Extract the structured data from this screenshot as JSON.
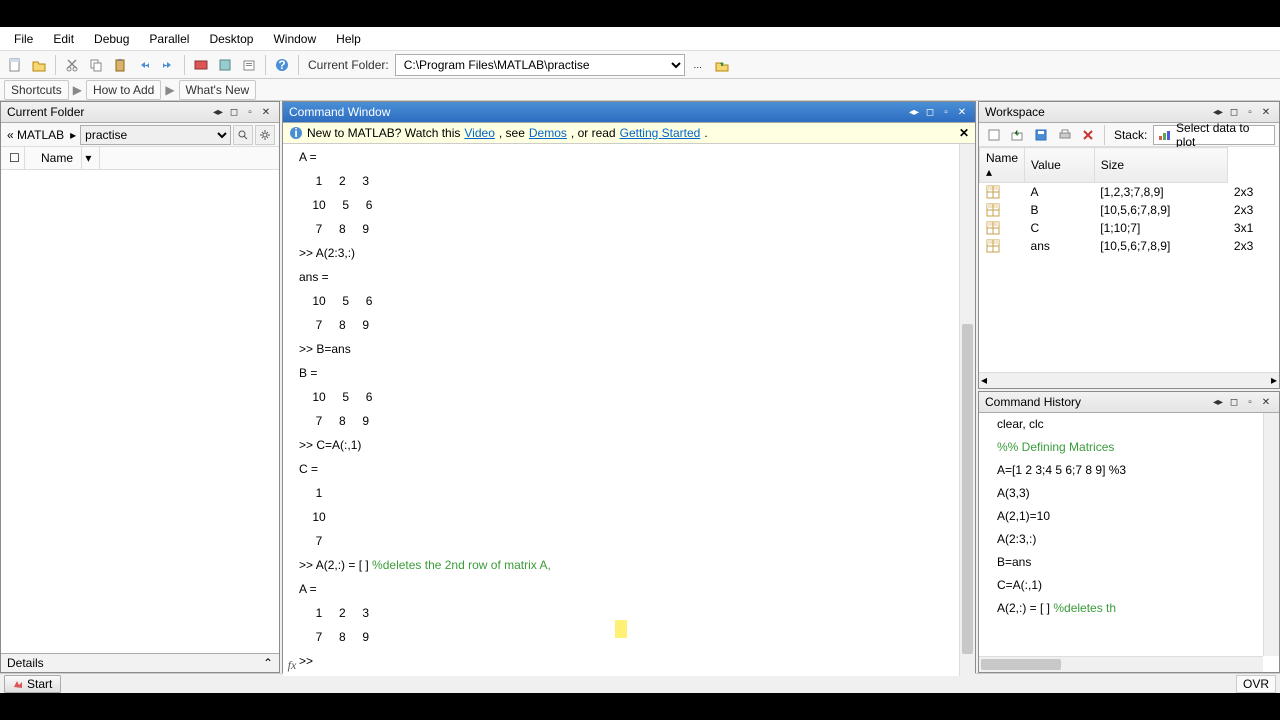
{
  "menubar": [
    "File",
    "Edit",
    "Debug",
    "Parallel",
    "Desktop",
    "Window",
    "Help"
  ],
  "toolbar": {
    "current_folder_label": "Current Folder:",
    "current_folder_value": "C:\\Program Files\\MATLAB\\practise"
  },
  "shortcuts_bar": {
    "shortcuts": "Shortcuts",
    "how_to_add": "How to Add",
    "whats_new": "What's New"
  },
  "left": {
    "title": "Current Folder",
    "breadcrumb_left": "« MATLAB",
    "breadcrumb_right": "practise",
    "name_col": "Name",
    "details": "Details"
  },
  "center": {
    "title": "Command Window",
    "banner_prefix": "New to MATLAB? Watch this ",
    "banner_video": "Video",
    "banner_mid1": ", see ",
    "banner_demos": "Demos",
    "banner_mid2": ", or read ",
    "banner_gs": "Getting Started",
    "banner_suffix": ".",
    "content": "A =\n     1     2     3\n    10     5     6\n     7     8     9\n>> A(2:3,:)\nans =\n    10     5     6\n     7     8     9\n>> B=ans\nB =\n    10     5     6\n     7     8     9\n>> C=A(:,1)\nC =\n     1\n    10\n     7\n>> A(2,:) = [ ] ",
    "comment": "%deletes the 2nd row of matrix A,",
    "content_after": "\nA =\n     1     2     3\n     7     8     9\n>> "
  },
  "right": {
    "ws_title": "Workspace",
    "stack_label": "Stack:",
    "plot_label": "Select data to plot",
    "cols": {
      "name": "Name",
      "value": "Value",
      "size": "Size"
    },
    "vars": [
      {
        "name": "A",
        "value": "[1,2,3;7,8,9]",
        "size": "2x3"
      },
      {
        "name": "B",
        "value": "[10,5,6;7,8,9]",
        "size": "2x3"
      },
      {
        "name": "C",
        "value": "[1;10;7]",
        "size": "3x1"
      },
      {
        "name": "ans",
        "value": "[10,5,6;7,8,9]",
        "size": "2x3"
      }
    ],
    "ch_title": "Command History",
    "history": [
      {
        "text": "clear, clc",
        "cls": ""
      },
      {
        "text": "%% Defining Matrices",
        "cls": "cmt"
      },
      {
        "text": "A=[1 2 3;4 5 6;7 8 9] %3",
        "cls": ""
      },
      {
        "text": "A(3,3)",
        "cls": ""
      },
      {
        "text": "A(2,1)=10",
        "cls": ""
      },
      {
        "text": "A(2:3,:)",
        "cls": ""
      },
      {
        "text": "B=ans",
        "cls": ""
      },
      {
        "text": "C=A(:,1)",
        "cls": ""
      },
      {
        "text": "A(2,:) = [ ] ",
        "cls": "",
        "comment": "%deletes th"
      }
    ]
  },
  "statusbar": {
    "start": "Start",
    "ovr": "OVR"
  }
}
